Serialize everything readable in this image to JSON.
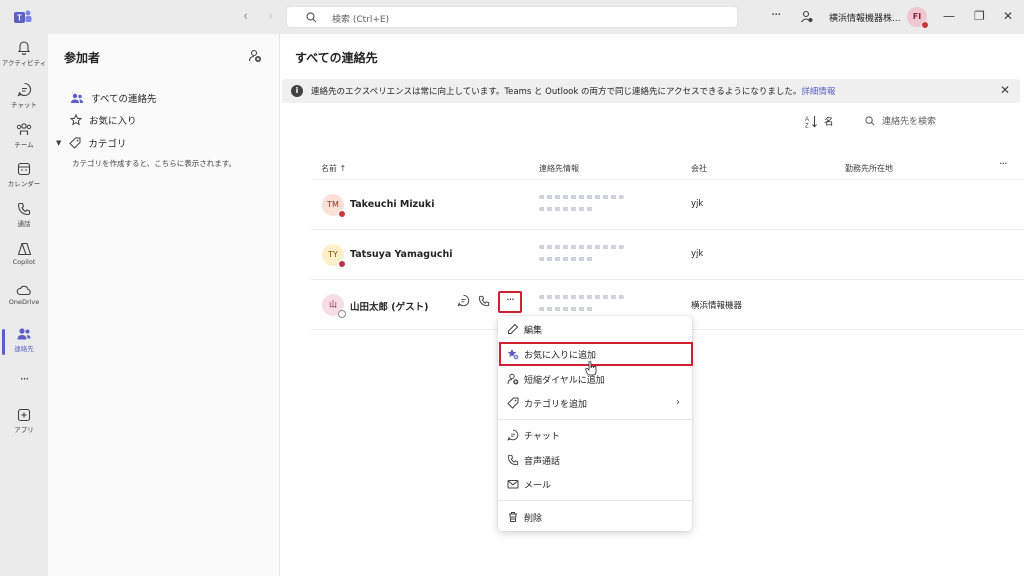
{
  "titlebar": {
    "search_placeholder": "検索 (Ctrl+E)",
    "more_label": "···",
    "org_name": "横浜情報機器株...",
    "user_initials": "FI",
    "back_arrow": "‹",
    "forward_arrow": "›",
    "minimize": "—",
    "restore": "❐",
    "close": "✕"
  },
  "rail": [
    {
      "label": "アクティビティ",
      "icon": "bell-icon"
    },
    {
      "label": "チャット",
      "icon": "chat-icon"
    },
    {
      "label": "チーム",
      "icon": "teams-icon"
    },
    {
      "label": "カレンダー",
      "icon": "calendar-icon"
    },
    {
      "label": "通話",
      "icon": "phone-icon"
    },
    {
      "label": "Copilot",
      "icon": "copilot-icon"
    },
    {
      "label": "OneDrive",
      "icon": "cloud-icon"
    },
    {
      "label": "連絡先",
      "icon": "people-icon",
      "active": true
    },
    {
      "label": "アプリ",
      "icon": "add-app-icon"
    }
  ],
  "rail_more": "···",
  "left_panel": {
    "title": "参加者",
    "items": [
      {
        "label": "すべての連絡先",
        "icon": "people-icon"
      },
      {
        "label": "お気に入り",
        "icon": "star-icon"
      },
      {
        "label": "カテゴリ",
        "icon": "tag-icon"
      }
    ],
    "category_hint": "カテゴリを作成すると、こちらに表示されます。"
  },
  "main": {
    "title": "すべての連絡先",
    "banner_text": "連絡先のエクスペリエンスは常に向上しています。Teams と Outlook の両方で同じ連絡先にアクセスできるようになりました。",
    "banner_link": "詳細情報",
    "sort_label": "名",
    "search_placeholder": "連絡先を検索",
    "columns": [
      "名前 ↑",
      "連絡先情報",
      "会社",
      "勤務先所在地"
    ],
    "contacts": [
      {
        "initials": "TM",
        "name": "Takeuchi Mizuki",
        "company": "yjk",
        "avatar_bg": "#fbe0d8",
        "avatar_fg": "#8a3b23",
        "status": "#d13438"
      },
      {
        "initials": "TY",
        "name": "Tatsuya Yamaguchi",
        "company": "yjk",
        "avatar_bg": "#fdf0c8",
        "avatar_fg": "#7a5a00",
        "status": "#c4314b"
      },
      {
        "initials": "山",
        "name": "山田太郎 (ゲスト)",
        "company": "横浜情報機器",
        "avatar_bg": "#f7dde6",
        "avatar_fg": "#8a2343",
        "status": "#8a8a8a"
      }
    ]
  },
  "context_menu": {
    "more_label": "···",
    "items": [
      {
        "label": "編集",
        "icon": "edit-icon"
      },
      {
        "label": "お気に入りに追加",
        "icon": "star-add-icon"
      },
      {
        "label": "短縮ダイヤルに追加",
        "icon": "speed-dial-icon"
      },
      {
        "label": "カテゴリを追加",
        "icon": "tag-icon",
        "submenu": "›"
      },
      {
        "label": "チャット",
        "icon": "chat-icon"
      },
      {
        "label": "音声通話",
        "icon": "phone-icon"
      },
      {
        "label": "メール",
        "icon": "mail-icon"
      },
      {
        "label": "削除",
        "icon": "trash-icon"
      }
    ]
  },
  "colors": {
    "accent": "#5b5fc7",
    "highlight": "#d02133"
  }
}
